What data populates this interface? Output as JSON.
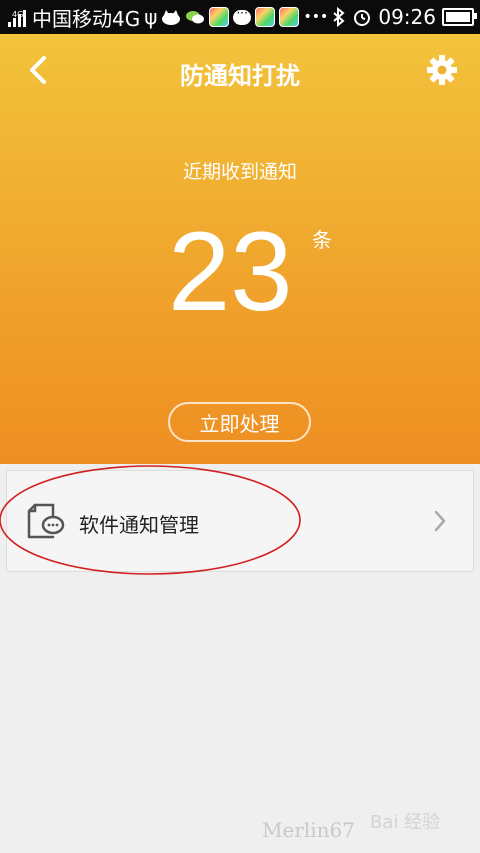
{
  "status_bar": {
    "network_tag": "4G",
    "carrier": "中国移动4G",
    "usb_glyph": "ψ",
    "time": "09:26",
    "more": "•••"
  },
  "header": {
    "title": "防通知打扰",
    "back_icon": "chevron-left-icon",
    "settings_icon": "gear-icon"
  },
  "summary": {
    "label": "近期收到通知",
    "count": "23",
    "unit": "条",
    "action_button": "立即处理"
  },
  "list": {
    "items": [
      {
        "label": "软件通知管理",
        "icon": "notification-doc-icon"
      }
    ]
  },
  "watermark": {
    "author": "Merlin67",
    "brand": "Bai 经验"
  },
  "colors": {
    "hero_top": "#f2c33b",
    "hero_bottom": "#ee8e22",
    "background": "#efefef",
    "annotation": "#d21f1f"
  }
}
